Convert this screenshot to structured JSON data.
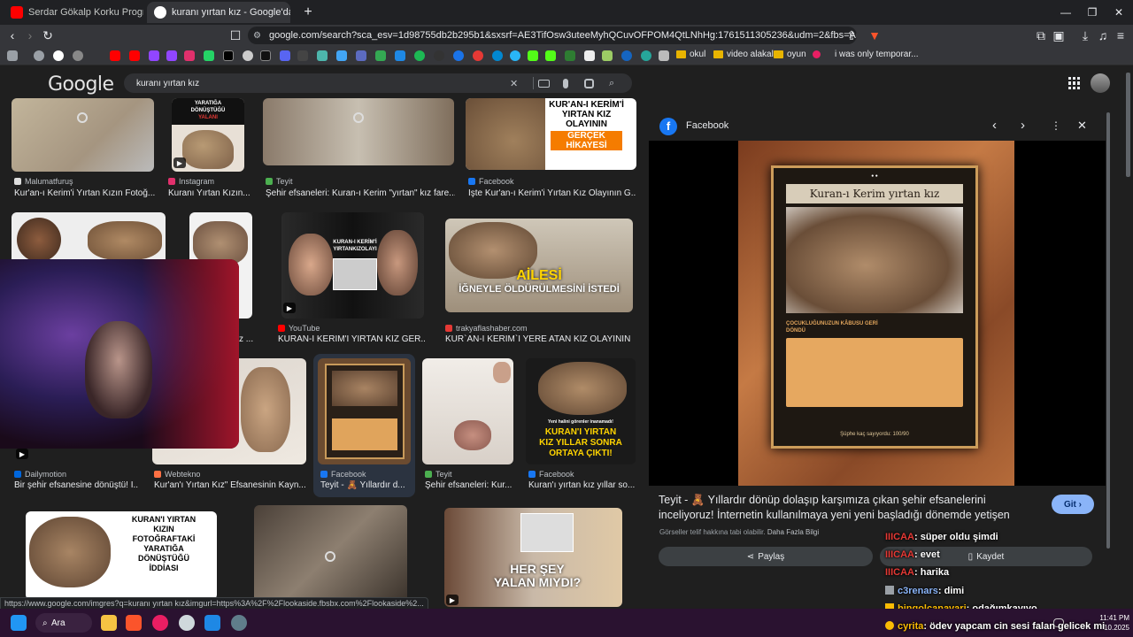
{
  "browser": {
    "tabs": [
      {
        "label": "Serdar Gökalp Korku Programı Bi",
        "icon": "youtube-icon"
      },
      {
        "label": "kuranı yırtan kız - Google'da Ara",
        "icon": "google-icon"
      }
    ],
    "new_tab": "+",
    "window_controls": {
      "minimize": "—",
      "restore": "❐",
      "close": "✕"
    },
    "url": "google.com/search?sca_esv=1d98755db2b295b1&sxsrf=AE3TifOsw3uteeMyhQCuvOFPOM4QtLNhHg:1761511305236&udm=2&fbs=AIljpHxnS6mJsAp76...",
    "bookmarks": [
      {
        "label": "okul"
      },
      {
        "label": "video alakalı"
      },
      {
        "label": "oyun"
      },
      {
        "label": "i was only temporar..."
      }
    ]
  },
  "google": {
    "logo": "Google",
    "query": "kuranı yırtan kız",
    "clear_icon": "✕"
  },
  "results": [
    {
      "source": "Malumatfuruş",
      "title": "Kur'an-ı Kerim'i Yırtan Kızın Fotoğ..."
    },
    {
      "source": "Instagram",
      "title": "Kuranı Yırtan Kızın...",
      "overlay_text": [
        "YARATIĞA",
        "DÖNÜŞTÜĞÜ",
        "YALANI"
      ]
    },
    {
      "source": "Teyit",
      "title": "Şehir efsaneleri: Kuran-ı Kerim \"yırtan\" kız fare..."
    },
    {
      "source": "Facebook",
      "title": "İşte Kur'an-ı Kerim'i Yırtan Kız Olayının G...",
      "overlay_text": [
        "KUR'AN-I KERİM'İ",
        "YIRTAN KIZ",
        "OLAYININ",
        "GERÇEK",
        "HİKAYESİ"
      ]
    },
    {
      "source": "",
      "title": "z ..."
    },
    {
      "source": "YouTube",
      "title": "KURAN-I KERİM'İ YIRTAN KIZ GER...",
      "overlay_text": [
        "KURAN-I KERİM'İ",
        "YIRTANKIZOLAYI"
      ]
    },
    {
      "source": "trakyaflashaber.com",
      "title": "KUR`AN-I KERİM`İ YERE ATAN KIZ OLAYININ ...",
      "overlay_text": [
        "AİLESİ",
        "İĞNEYLE ÖLDÜRÜLMESİNİ İSTEDİ"
      ]
    },
    {
      "source": "Dailymotion",
      "title": "Bir şehir efsanesine dönüştü! İ..."
    },
    {
      "source": "Webtekno",
      "title": "Kur'an'ı Yırtan Kız\" Efsanesinin Kayn..."
    },
    {
      "source": "Facebook",
      "title": "Teyit - 🧸 Yıllardır d..."
    },
    {
      "source": "Teyit",
      "title": "Şehir efsaneleri: Kur..."
    },
    {
      "source": "Facebook",
      "title": "Kuran'ı yırtan kız yıllar so...",
      "overlay_text": [
        "Yeni halini görenler inanamadı!",
        "KURAN'I YIRTAN",
        "KIZ YILLAR SONRA",
        "ORTAYA ÇIKTI!"
      ]
    },
    {
      "source": "",
      "title": "",
      "overlay_text": [
        "KURAN'I YIRTAN",
        "KIZIN",
        "FOTOĞRAFTAKİ",
        "YARATIĞA",
        "DÖNÜŞTÜĞÜ",
        "İDDİASI"
      ]
    },
    {
      "source": "",
      "title": "",
      "overlay_text": [
        "HER ŞEY",
        "YALAN MIYDI?"
      ]
    }
  ],
  "panel": {
    "source": "Facebook",
    "image_text": {
      "banner": "Kuran-ı Kerim yırtan kız",
      "subtitle": "ÇOCUKLUĞUNUZUN KÂBUSU GERİ DÖNDÜ",
      "footer": "Şüphe kaç sayıyordu: 100/90"
    },
    "description": "Teyit - 🧸 Yıllardır dönüp dolaşıp karşımıza çıkan şehir efsanelerini inceliyoruz! İnternetin kullanılmaya yeni yeni başladığı dönemde yetişen neslin rüyasından...",
    "go_label": "Git",
    "copyright": "Görseller telif hakkına tabi olabilir.",
    "more_info": "Daha Fazla Bilgi",
    "share_label": "Paylaş",
    "save_label": "Kaydet"
  },
  "chat": [
    {
      "user": "IIICAA",
      "message": ": süper oldu şimdi",
      "color": "#e53935"
    },
    {
      "user": "IIICAA",
      "message": ": evet",
      "color": "#e53935"
    },
    {
      "user": "IIICAA",
      "message": ": harika",
      "color": "#e53935"
    },
    {
      "user": "c3renars",
      "message": ": dimi",
      "color": "#8ab4f8"
    },
    {
      "user": "bingolcanavari",
      "message": ": odağımkayıyo",
      "color": "#fbbc04"
    },
    {
      "user": "cyrita",
      "message": ": ödev yapcam cin sesi falan gelicek mi",
      "color": "#fbbc04"
    }
  ],
  "status_url": "https://www.google.com/imgres?q=kuranı yırtan kız&imgurl=https%3A%2F%2Flookaside.fbsbx.com%2Flookaside%2...",
  "taskbar": {
    "search_label": "Ara",
    "time": "11:41 PM",
    "date": "10.2025"
  }
}
